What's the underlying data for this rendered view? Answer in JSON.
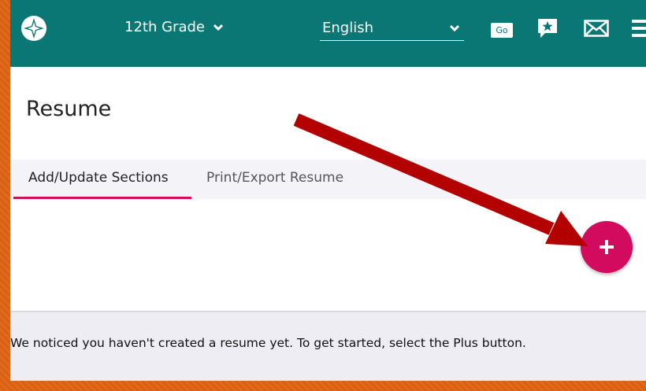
{
  "header": {
    "grade_label": "12th Grade",
    "language_value": "English",
    "go_label": "Go"
  },
  "page": {
    "title": "Resume"
  },
  "tabs": [
    {
      "label": "Add/Update Sections",
      "active": true
    },
    {
      "label": "Print/Export Resume",
      "active": false
    }
  ],
  "empty_state": {
    "message": "We noticed you haven't created a resume yet. To get started, select the Plus button."
  },
  "colors": {
    "header_bg": "#0a7775",
    "accent": "#d20b5e",
    "annotation_arrow": "#b30000",
    "border_orange": "#e06a1c"
  },
  "icons": {
    "logo": "compass-logo-icon",
    "grade_dropdown": "chevron-down-icon",
    "language_dropdown": "chevron-down-icon",
    "chat": "chat-star-icon",
    "mail": "mail-icon",
    "menu": "hamburger-menu-icon",
    "add": "plus-icon"
  }
}
